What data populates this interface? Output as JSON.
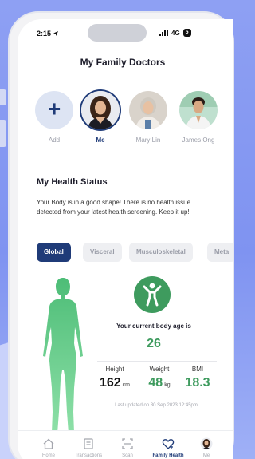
{
  "status_bar": {
    "time": "2:15",
    "network": "4G",
    "battery": "5"
  },
  "header": {
    "title": "My Family Doctors"
  },
  "doctors": [
    {
      "label": "Add",
      "type": "add"
    },
    {
      "label": "Me",
      "type": "avatar",
      "selected": true
    },
    {
      "label": "Mary Lin",
      "type": "avatar"
    },
    {
      "label": "James Ong",
      "type": "avatar"
    }
  ],
  "health_status": {
    "title": "My Health Status",
    "description": "Your Body is in a good shape! There is no health issue detected from your latest health screening. Keep it up!"
  },
  "tabs": [
    {
      "label": "Global",
      "active": true
    },
    {
      "label": "Visceral",
      "active": false
    },
    {
      "label": "Musculoskeletal",
      "active": false
    },
    {
      "label": "Meta",
      "active": false
    }
  ],
  "body_age": {
    "label": "Your current body age is",
    "value": "26"
  },
  "metrics": {
    "height": {
      "label": "Height",
      "value": "162",
      "unit": "cm"
    },
    "weight": {
      "label": "Weight",
      "value": "48",
      "unit": "kg"
    },
    "bmi": {
      "label": "BMI",
      "value": "18.3",
      "unit": ""
    }
  },
  "updated_text": "Last updated on 30 Sep 2023 12:45pm",
  "tabbar": [
    {
      "label": "Home",
      "icon": "home-icon",
      "active": false
    },
    {
      "label": "Transactions",
      "icon": "receipt-icon",
      "active": false
    },
    {
      "label": "Scan",
      "icon": "scan-icon",
      "active": false
    },
    {
      "label": "Family Health",
      "icon": "heart-plus-icon",
      "active": true
    },
    {
      "label": "Me",
      "icon": "profile-avatar-icon",
      "active": false
    }
  ],
  "colors": {
    "primary": "#1f3b78",
    "green": "#3e9b5e",
    "figure_green": "#6fcf90",
    "muted": "#9a9da8"
  }
}
